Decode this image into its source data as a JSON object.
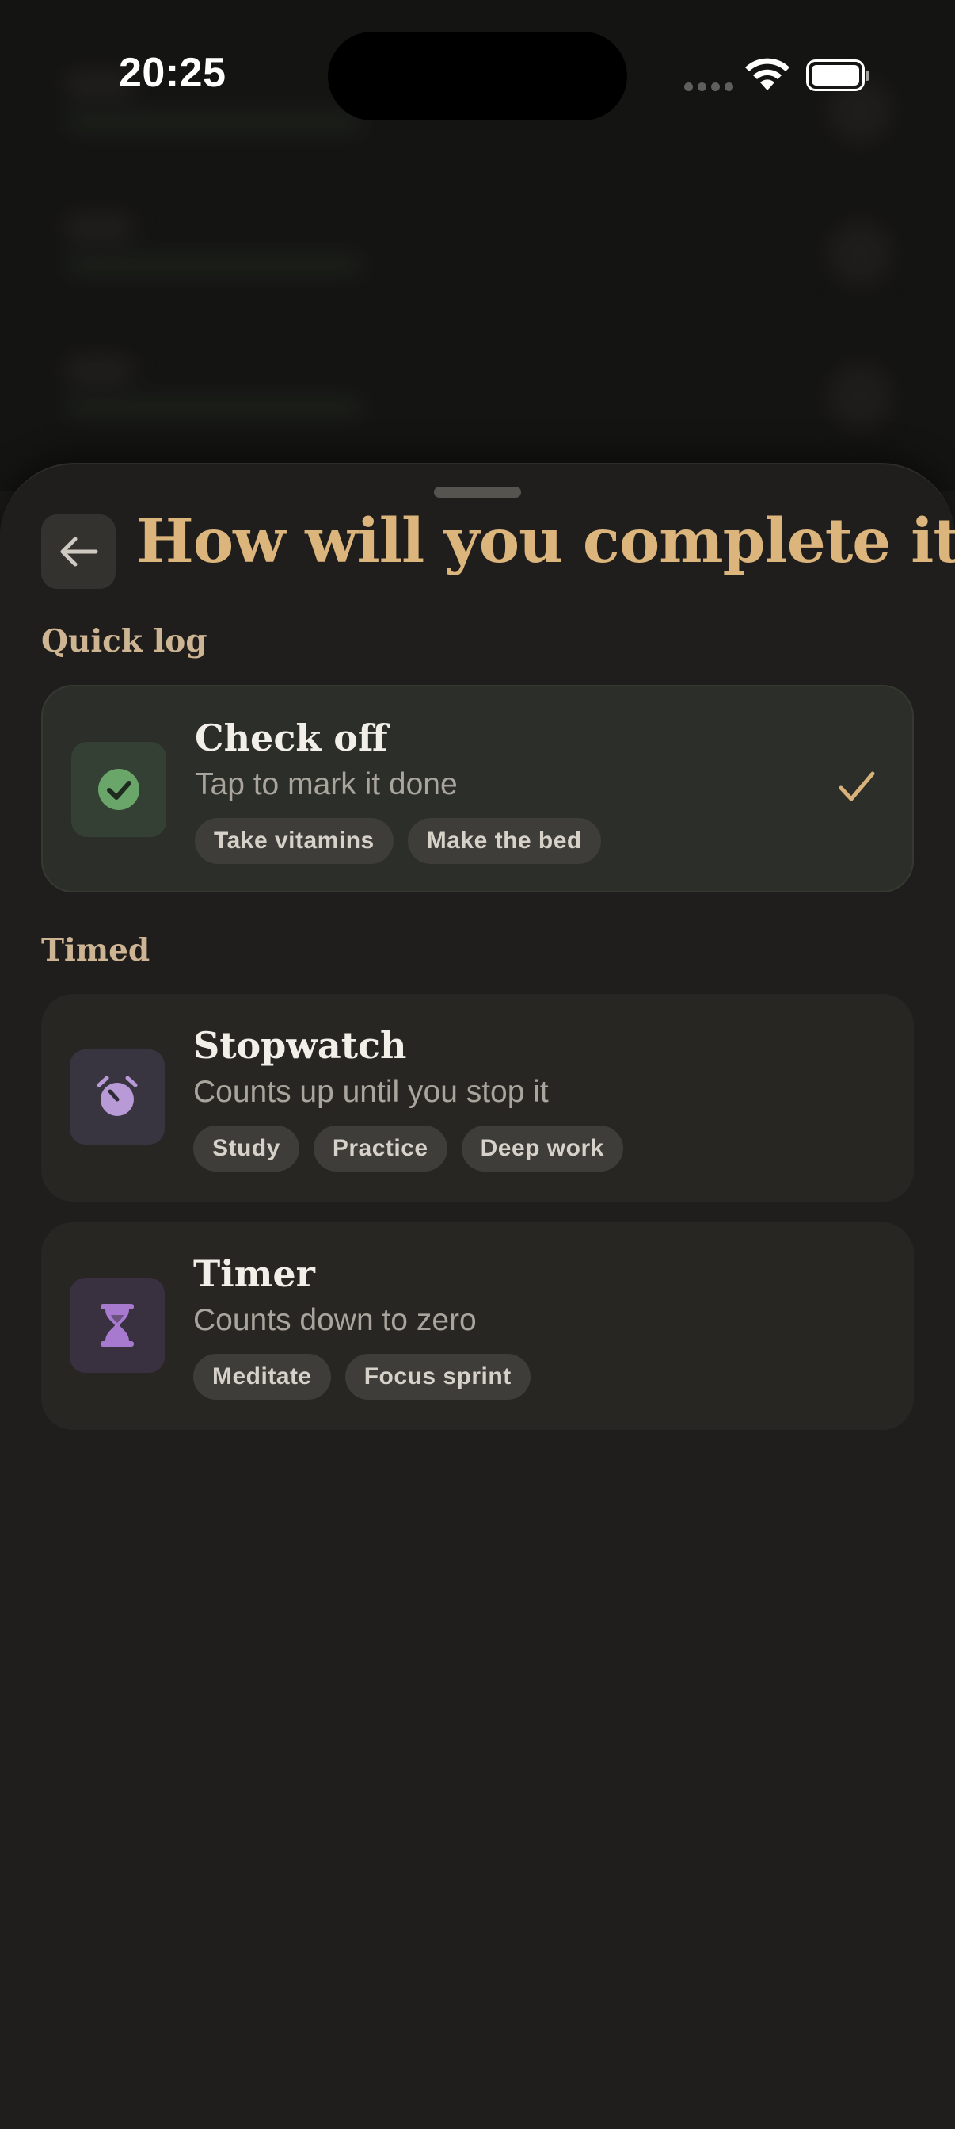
{
  "status_bar": {
    "time": "20:25"
  },
  "sheet": {
    "title": "How will you complete it?",
    "sections": [
      {
        "label": "Quick log",
        "options": [
          {
            "title": "Check off",
            "subtitle": "Tap to mark it done",
            "icon": "check-circle-icon",
            "selected": true,
            "chips": [
              "Take vitamins",
              "Make the bed"
            ]
          }
        ]
      },
      {
        "label": "Timed",
        "options": [
          {
            "title": "Stopwatch",
            "subtitle": "Counts up until you stop it",
            "icon": "alarm-clock-icon",
            "selected": false,
            "chips": [
              "Study",
              "Practice",
              "Deep work"
            ]
          },
          {
            "title": "Timer",
            "subtitle": "Counts down to zero",
            "icon": "hourglass-icon",
            "selected": false,
            "chips": [
              "Meditate",
              "Focus sprint"
            ]
          }
        ]
      }
    ]
  },
  "colors": {
    "accent": "#dcb57c",
    "check_green": "#6aa66a",
    "stopwatch_purple": "#b89ad6",
    "timer_purple": "#a77ad0",
    "selected_check": "#d8b27a"
  }
}
